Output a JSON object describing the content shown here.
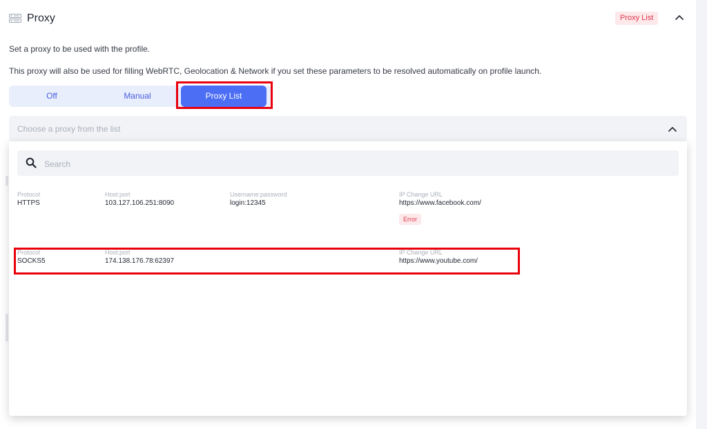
{
  "section": {
    "title": "Proxy",
    "badge": "Proxy List",
    "icon": "server-icon"
  },
  "description": {
    "line1": "Set a proxy to be used with the profile.",
    "line2": "This proxy will also be used for filling WebRTC, Geolocation & Network if you set these parameters to be resolved automatically on profile launch."
  },
  "modes": {
    "off": "Off",
    "manual": "Manual",
    "proxy_list": "Proxy List",
    "selected": "Proxy List"
  },
  "select": {
    "placeholder": "Choose a proxy from the list"
  },
  "search": {
    "placeholder": "Search",
    "value": ""
  },
  "columns": {
    "protocol": "Protocol",
    "host": "Host:port",
    "credentials": "Username:password",
    "ip_change": "IP Change URL"
  },
  "proxies": [
    {
      "protocol": "HTTPS",
      "host": "103.127.106.251:8090",
      "credentials": "login:12345",
      "ip_change": "https://www.facebook.com/",
      "status": "Error"
    },
    {
      "protocol": "SOCKS5",
      "host": "174.138.176.78:62397",
      "ip_change": "https://www.youtube.com/"
    }
  ],
  "colors": {
    "accent": "#4c6ef5",
    "error": "#e0394f",
    "highlight": "#e8000b"
  }
}
